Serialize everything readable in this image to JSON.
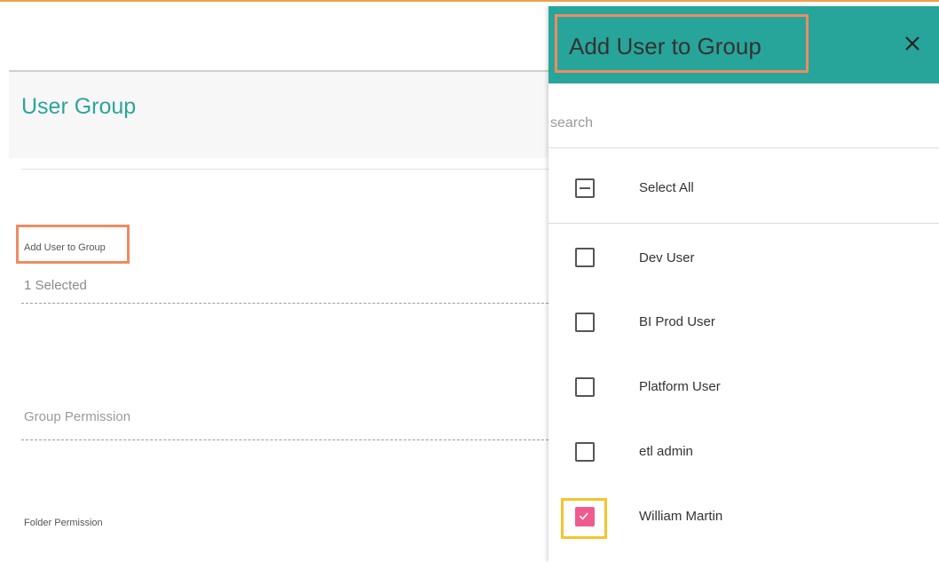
{
  "page": {
    "title": "User Group",
    "fields": {
      "add_user_label": "Add User to Group",
      "add_user_value": "1 Selected",
      "group_permission": "Group Permission",
      "folder_permission": "Folder Permission"
    }
  },
  "panel": {
    "title": "Add User to Group",
    "close_icon": "close-icon",
    "search_placeholder": "search",
    "select_all": "Select All",
    "users": [
      {
        "label": "Dev User",
        "checked": false
      },
      {
        "label": "BI Prod User",
        "checked": false
      },
      {
        "label": "Platform User",
        "checked": false
      },
      {
        "label": "etl admin",
        "checked": false
      },
      {
        "label": "William Martin",
        "checked": true
      }
    ]
  },
  "colors": {
    "accent_teal": "#27a59a",
    "highlight_orange": "#ee8b63",
    "highlight_yellow": "#f5c42c",
    "checked_pink": "#f05a8f"
  }
}
